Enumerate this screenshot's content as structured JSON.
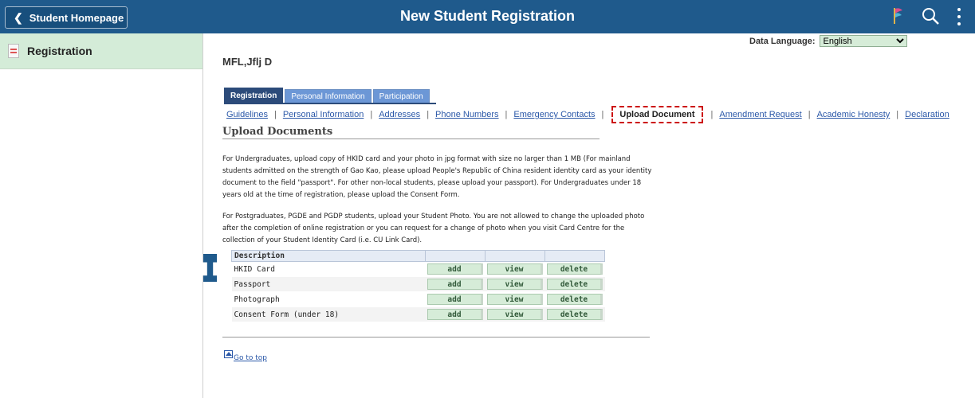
{
  "header": {
    "back_label": "Student Homepage",
    "title": "New Student Registration",
    "icons": [
      "flag-icon",
      "search-icon",
      "menu-icon"
    ]
  },
  "sidebar": {
    "items": [
      {
        "label": "Registration",
        "active": true
      }
    ]
  },
  "language": {
    "label": "Data Language:",
    "selected": "English"
  },
  "student_name": "MFL,Jflj D",
  "tabs": [
    {
      "label": "Registration",
      "active": true
    },
    {
      "label": "Personal Information",
      "active": false
    },
    {
      "label": "Participation",
      "active": false
    }
  ],
  "subnav": [
    "Guidelines",
    "Personal Information",
    "Addresses",
    "Phone Numbers",
    "Emergency Contacts",
    "Upload Document",
    "Amendment Request",
    "Academic Honesty",
    "Declaration"
  ],
  "section_title": "Upload Documents",
  "paragraphs": {
    "p1": "For Undergraduates, upload copy of HKID card and your photo in jpg format with size no larger than 1 MB (For mainland students admitted on the strength of Gao Kao, please upload People's Republic of China resident identity card as your identity document to the field \"passport\". For other non-local students, please upload your passport). For Undergraduates under 18 years old at the time of registration, please upload the Consent Form.",
    "p2": "For Postgraduates, PGDE and PGDP students, upload your Student Photo. You are not allowed to change the uploaded photo after the completion of online registration or you can request for a change of photo when you visit Card Centre for the collection of your Student Identity Card (i.e. CU Link Card)."
  },
  "table": {
    "header": "Description",
    "buttons": {
      "add": "add",
      "view": "view",
      "delete": "delete"
    },
    "rows": [
      "HKID Card",
      "Passport",
      "Photograph",
      "Consent Form (under 18)"
    ]
  },
  "go_to_top": "Go to top",
  "colors": {
    "header_bg": "#1f5a8c",
    "nav_active_bg": "#d4ecd8",
    "tab_active": "#2c4b7a",
    "tab_inactive": "#6c97d6",
    "button_bg": "#d6ecd8",
    "highlight_border": "#cc1111"
  }
}
